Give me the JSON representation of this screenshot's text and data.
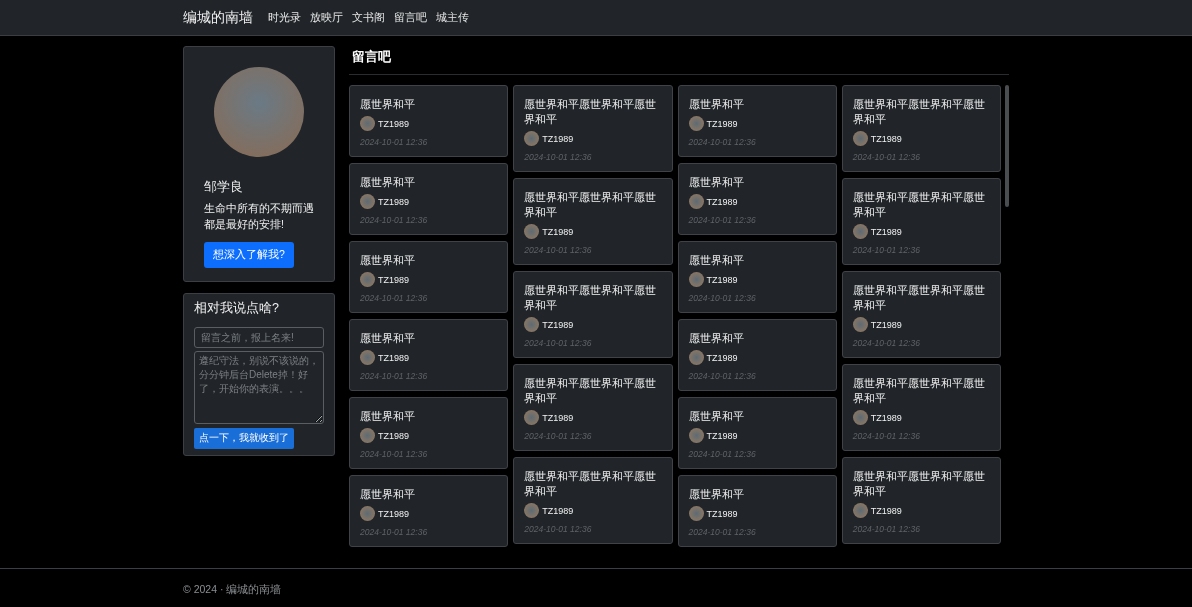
{
  "navbar": {
    "brand": "编城的南墙",
    "links": [
      "时光录",
      "放映厅",
      "文书阁",
      "留言吧",
      "城主传"
    ]
  },
  "profile": {
    "name": "邹学良",
    "motto": "生命中所有的不期而遇都是最好的安排!",
    "button": "想深入了解我?"
  },
  "message_form": {
    "title": "相对我说点啥?",
    "name_field": {
      "placeholder": "留言之前，报上名来!"
    },
    "message_field": {
      "placeholder": "遵纪守法，别说不该说的，分分钟后台Delete掉！好了，开始你的表演。。。"
    },
    "submit": "点一下，我就收到了"
  },
  "board": {
    "title": "留言吧",
    "columns": [
      [
        {
          "text": "愿世界和平",
          "user": "TZ1989",
          "time": "2024-10-01 12:36"
        },
        {
          "text": "愿世界和平",
          "user": "TZ1989",
          "time": "2024-10-01 12:36"
        },
        {
          "text": "愿世界和平",
          "user": "TZ1989",
          "time": "2024-10-01 12:36"
        },
        {
          "text": "愿世界和平",
          "user": "TZ1989",
          "time": "2024-10-01 12:36"
        },
        {
          "text": "愿世界和平",
          "user": "TZ1989",
          "time": "2024-10-01 12:36"
        },
        {
          "text": "愿世界和平",
          "user": "TZ1989",
          "time": "2024-10-01 12:36"
        }
      ],
      [
        {
          "text": "愿世界和平愿世界和平愿世界和平",
          "user": "TZ1989",
          "time": "2024-10-01 12:36"
        },
        {
          "text": "愿世界和平愿世界和平愿世界和平",
          "user": "TZ1989",
          "time": "2024-10-01 12:36"
        },
        {
          "text": "愿世界和平愿世界和平愿世界和平",
          "user": "TZ1989",
          "time": "2024-10-01 12:36"
        },
        {
          "text": "愿世界和平愿世界和平愿世界和平",
          "user": "TZ1989",
          "time": "2024-10-01 12:36"
        },
        {
          "text": "愿世界和平愿世界和平愿世界和平",
          "user": "TZ1989",
          "time": "2024-10-01 12:36"
        }
      ],
      [
        {
          "text": "愿世界和平",
          "user": "TZ1989",
          "time": "2024-10-01 12:36"
        },
        {
          "text": "愿世界和平",
          "user": "TZ1989",
          "time": "2024-10-01 12:36"
        },
        {
          "text": "愿世界和平",
          "user": "TZ1989",
          "time": "2024-10-01 12:36"
        },
        {
          "text": "愿世界和平",
          "user": "TZ1989",
          "time": "2024-10-01 12:36"
        },
        {
          "text": "愿世界和平",
          "user": "TZ1989",
          "time": "2024-10-01 12:36"
        },
        {
          "text": "愿世界和平",
          "user": "TZ1989",
          "time": "2024-10-01 12:36"
        }
      ],
      [
        {
          "text": "愿世界和平愿世界和平愿世界和平",
          "user": "TZ1989",
          "time": "2024-10-01 12:36"
        },
        {
          "text": "愿世界和平愿世界和平愿世界和平",
          "user": "TZ1989",
          "time": "2024-10-01 12:36"
        },
        {
          "text": "愿世界和平愿世界和平愿世界和平",
          "user": "TZ1989",
          "time": "2024-10-01 12:36"
        },
        {
          "text": "愿世界和平愿世界和平愿世界和平",
          "user": "TZ1989",
          "time": "2024-10-01 12:36"
        },
        {
          "text": "愿世界和平愿世界和平愿世界和平",
          "user": "TZ1989",
          "time": "2024-10-01 12:36"
        }
      ]
    ]
  },
  "footer": "© 2024 · 编城的南墙"
}
